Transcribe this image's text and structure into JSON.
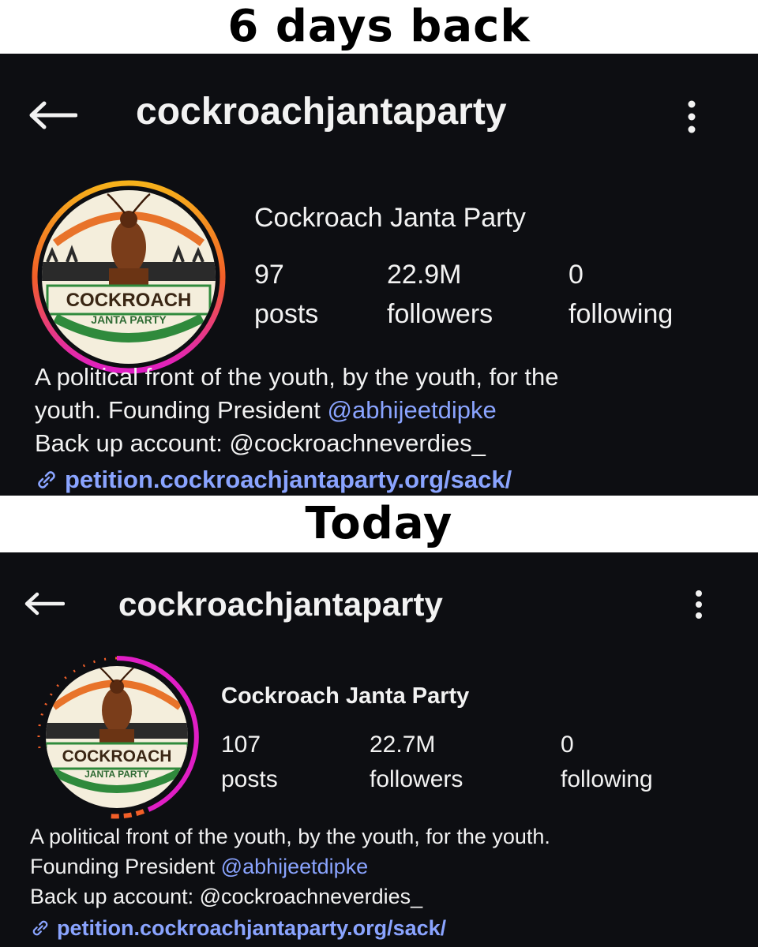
{
  "captions": {
    "top": "6 days back",
    "bottom": "Today"
  },
  "colors": {
    "panel_bg": "#0d0e12",
    "text": "#f2f2f2",
    "link": "#8aa4ff"
  },
  "icons": {
    "back": "arrow-left-icon",
    "more": "more-vertical-icon",
    "link": "link-icon"
  },
  "avatar_text": {
    "line1": "COCKROACH",
    "line2": "JANTA PARTY"
  },
  "before": {
    "username": "cockroachjantaparty",
    "display_name": "Cockroach Janta Party",
    "posts": "97",
    "posts_label": "posts",
    "followers": "22.9M",
    "followers_label": "followers",
    "following": "0",
    "following_label": "following",
    "bio_1": "A political front of the youth, by the youth, for the",
    "bio_2_prefix": "youth. Founding President ",
    "bio_2_mention": "@abhijeetdipke",
    "bio_3": "Back up account: @cockroachneverdies_",
    "link": "petition.cockroachjantaparty.org/sack/"
  },
  "after": {
    "username": "cockroachjantaparty",
    "display_name": "Cockroach Janta Party",
    "posts": "107",
    "posts_label": "posts",
    "followers": "22.7M",
    "followers_label": "followers",
    "following": "0",
    "following_label": "following",
    "bio_1": "A political front of the youth, by the youth, for the youth.",
    "bio_2_prefix": "Founding President ",
    "bio_2_mention": "@abhijeetdipke",
    "bio_3": "Back up account: @cockroachneverdies_",
    "link": "petition.cockroachjantaparty.org/sack/"
  }
}
